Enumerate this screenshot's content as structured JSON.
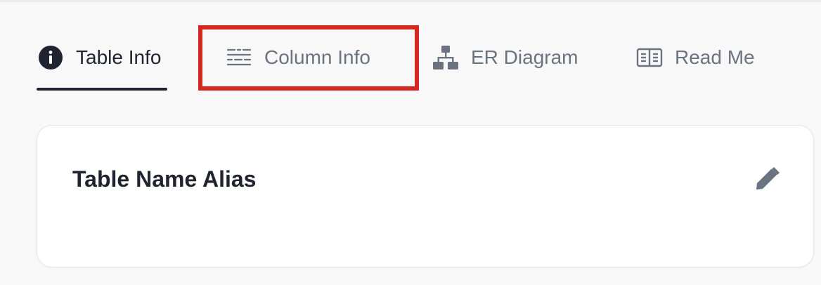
{
  "tabs": [
    {
      "label": "Table Info",
      "icon": "info-icon",
      "active": true
    },
    {
      "label": "Column Info",
      "icon": "column-list-icon",
      "active": false,
      "highlighted": true
    },
    {
      "label": "ER Diagram",
      "icon": "hierarchy-icon",
      "active": false
    },
    {
      "label": "Read Me",
      "icon": "open-book-icon",
      "active": false
    }
  ],
  "card": {
    "title": "Table Name Alias",
    "edit_icon": "pencil-icon"
  },
  "colors": {
    "active_text": "#1f2430",
    "inactive_text": "#6b7280",
    "highlight_border": "#d4281e",
    "card_background": "#ffffff",
    "page_background": "#f8f8f9"
  }
}
